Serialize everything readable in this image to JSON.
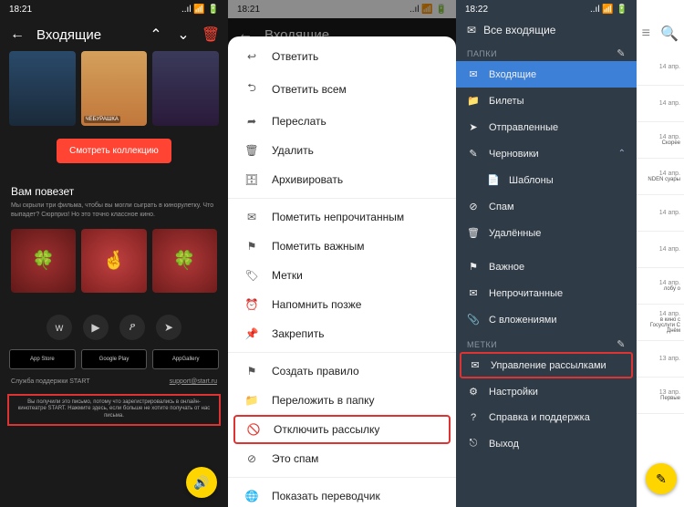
{
  "status": {
    "t1": "18:21",
    "t2": "18:21",
    "t3": "18:22",
    "sig": "📶",
    "wifi": "📶",
    "bat": "🔋"
  },
  "p1": {
    "title": "Входящие",
    "posters": [
      "",
      "ЧЕБУРАШКА",
      ""
    ],
    "collection_btn": "Смотреть коллекцию",
    "lucky_title": "Вам повезет",
    "lucky_text": "Мы скрыли три фильма, чтобы вы могли сыграть в кинорулетку. Что выпадет? Сюрприз! Но это точно классное кино.",
    "clovers": [
      "🍀",
      "🤞",
      "🍀"
    ],
    "stores": [
      "App Store",
      "Google Play",
      "AppGallery"
    ],
    "support_label": "Служба поддержки START",
    "support_email": "support@start.ru",
    "footer_text": "Вы получили это письмо, потому что зарегистрировались в онлайн-кинотеатре START. Нажмите здесь, если больше не хотите получать от нас письма."
  },
  "p2": {
    "title": "Входящие",
    "items": [
      {
        "ico": "↩",
        "label": "Ответить"
      },
      {
        "ico": "⮌",
        "label": "Ответить всем"
      },
      {
        "ico": "➦",
        "label": "Переслать"
      },
      {
        "ico": "🗑",
        "label": "Удалить"
      },
      {
        "ico": "🗄",
        "label": "Архивировать"
      },
      {
        "sep": true
      },
      {
        "ico": "✉",
        "label": "Пометить непрочитанным"
      },
      {
        "ico": "⚑",
        "label": "Пометить важным"
      },
      {
        "ico": "🏷",
        "label": "Метки"
      },
      {
        "ico": "⏰",
        "label": "Напомнить позже"
      },
      {
        "ico": "📌",
        "label": "Закрепить"
      },
      {
        "sep": true
      },
      {
        "ico": "⚑",
        "label": "Создать правило"
      },
      {
        "ico": "📁",
        "label": "Переложить в папку"
      },
      {
        "ico": "🚫",
        "label": "Отключить рассылку",
        "hl": true
      },
      {
        "ico": "⊘",
        "label": "Это спам"
      },
      {
        "sep": true
      },
      {
        "ico": "🌐",
        "label": "Показать переводчик"
      }
    ]
  },
  "p3": {
    "all_inbox": "Все входящие",
    "sect_folders": "ПАПКИ",
    "sect_labels": "МЕТКИ",
    "folders": [
      {
        "ico": "✉",
        "label": "Входящие",
        "active": true
      },
      {
        "ico": "📁",
        "label": "Билеты"
      },
      {
        "ico": "➤",
        "label": "Отправленные"
      },
      {
        "ico": "✎",
        "label": "Черновики",
        "chev": "⌃"
      },
      {
        "ico": "📄",
        "label": "Шаблоны",
        "sub": true
      },
      {
        "ico": "⊘",
        "label": "Спам"
      },
      {
        "ico": "🗑",
        "label": "Удалённые"
      }
    ],
    "views": [
      {
        "ico": "⚑",
        "label": "Важное"
      },
      {
        "ico": "✉",
        "label": "Непрочитанные"
      },
      {
        "ico": "📎",
        "label": "С вложениями"
      }
    ],
    "bottom": [
      {
        "ico": "✉",
        "label": "Управление рассылками",
        "hl": true
      },
      {
        "ico": "⚙",
        "label": "Настройки"
      },
      {
        "ico": "?",
        "label": "Справка и поддержка"
      },
      {
        "ico": "⎋",
        "label": "Выход"
      }
    ],
    "bg_dates": [
      "14 апр.",
      "14 апр.",
      "14 апр.",
      "14 апр.",
      "14 апр.",
      "14 апр.",
      "14 апр.",
      "14 апр.",
      "13 апр.",
      "13 апр."
    ],
    "bg_snips": [
      "",
      "",
      "Скорее",
      "NDEN\nсуары",
      "",
      "",
      "лобу\nо",
      "в кино с\nГосуслуги\nС Днём",
      "",
      "Первые"
    ]
  }
}
